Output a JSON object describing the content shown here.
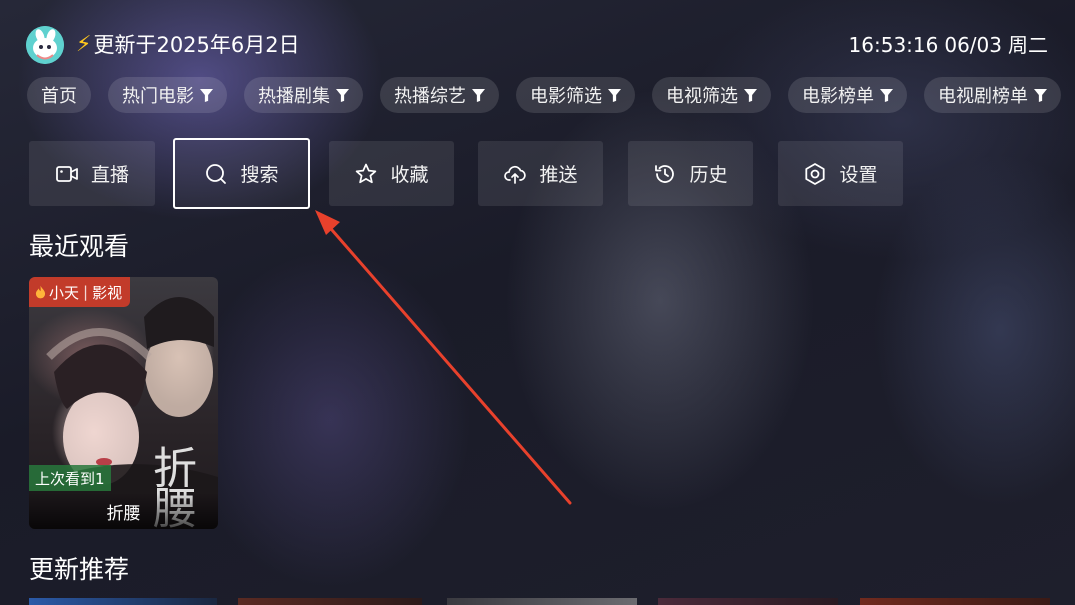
{
  "header": {
    "bolt_glyph": "⚡",
    "update_text": "更新于2025年6月2日",
    "time": "16:53:16",
    "date": "06/03",
    "weekday": "周二"
  },
  "nav": {
    "items": [
      {
        "label": "首页",
        "filter": false
      },
      {
        "label": "热门电影",
        "filter": true
      },
      {
        "label": "热播剧集",
        "filter": true
      },
      {
        "label": "热播综艺",
        "filter": true
      },
      {
        "label": "电影筛选",
        "filter": true
      },
      {
        "label": "电视筛选",
        "filter": true
      },
      {
        "label": "电影榜单",
        "filter": true
      },
      {
        "label": "电视剧榜单",
        "filter": true
      }
    ]
  },
  "actions": {
    "live": "直播",
    "search": "搜索",
    "favorite": "收藏",
    "push": "推送",
    "history": "历史",
    "settings": "设置"
  },
  "recent": {
    "title": "最近观看",
    "card": {
      "source_left": "小天",
      "source_sep": "|",
      "source_right": "影视",
      "poster_text": "折腰",
      "progress": "上次看到1",
      "title": "折腰"
    }
  },
  "recommend": {
    "title": "更新推荐"
  },
  "colors": {
    "accent_bolt": "#ffc81e",
    "badge_red": "#c23b2a",
    "progress_green": "#287840",
    "arrow_red": "#e8412c",
    "focus_border": "#ffffff"
  }
}
